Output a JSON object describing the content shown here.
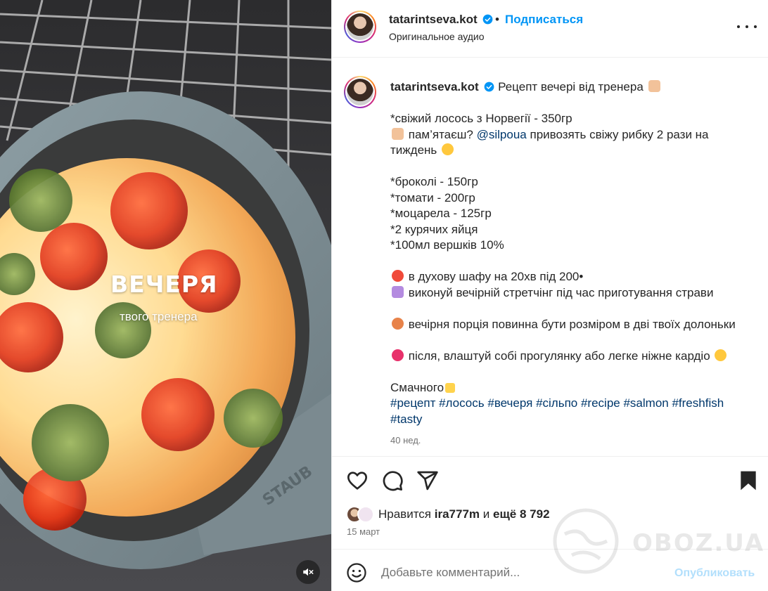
{
  "media": {
    "overlay_title": "ВЕЧЕРЯ",
    "overlay_subtitle": "твого тренера",
    "mute_icon": "speaker-muted-icon",
    "pan_brand": "STAUB"
  },
  "header": {
    "username": "tatarintseva.kot",
    "separator": "•",
    "follow_label": "Подписаться",
    "audio_label": "Оригинальное аудио",
    "more_icon": "more-horizontal-icon"
  },
  "caption": {
    "username": "tatarintseva.kot",
    "title_text": "Рецепт вечері від тренера",
    "line1": "*свіжий лосось з Норвегії - 350гр",
    "line2_before": "пам’ятаєш?",
    "line2_mention": "@silpoua",
    "line2_after": "привозять свіжу рибку 2 рази на",
    "line3": "тиждень",
    "ing1": "*броколі - 150гр",
    "ing2": "*томати - 200гр",
    "ing3": "*моцарела - 125гр",
    "ing4": "*2 курячих яйця",
    "ing5": "*100мл вершків 10%",
    "step1": "в духову шафу на 20хв під 200•",
    "step2": "виконуй вечірній стретчінг під час приготування страви",
    "step3": "вечірня порція повинна бути розміром в дві твоїх долоньки",
    "step4": "після, влаштуй собі прогулянку або легке ніжне кардіо",
    "closing": "Смачного",
    "hashtags_line1": [
      "#рецепт",
      "#лосось",
      "#вечеря",
      "#сільпо",
      "#recipe",
      "#salmon",
      "#freshfish"
    ],
    "hashtags_line2": [
      "#tasty"
    ],
    "time_ago": "40 нед."
  },
  "actions": {
    "like_icon": "heart-icon",
    "comment_icon": "comment-icon",
    "share_icon": "send-icon",
    "save_icon": "bookmark-icon",
    "likes_prefix": "Нравится",
    "likes_user": "ira777m",
    "likes_middle": "и",
    "likes_count": "ещё 8 792",
    "date": "15 март"
  },
  "comment": {
    "emoji_icon": "smiley-icon",
    "placeholder": "Добавьте комментарий...",
    "publish_label": "Опубликовать"
  },
  "watermark": {
    "text": "OBOZ.UA"
  },
  "colors": {
    "link": "#00376b",
    "follow": "#0095f6",
    "publish_disabled": "#b2dffc",
    "muted_text": "#737373"
  }
}
